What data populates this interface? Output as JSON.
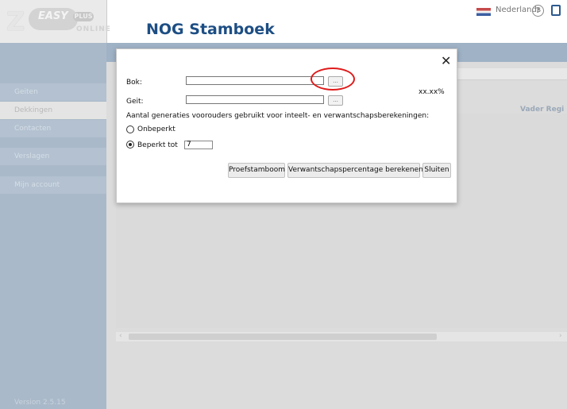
{
  "header": {
    "logo_text": "ZOO EASY PLUS ONLINE",
    "title": "NOG Stamboek",
    "language": "Nederlands",
    "help_symbol": "?"
  },
  "sidebar": {
    "items": [
      {
        "label": "Geiten"
      },
      {
        "label": "Dekkingen"
      },
      {
        "label": "Contacten"
      },
      {
        "label": "Verslagen"
      },
      {
        "label": "Mijn account"
      }
    ],
    "version": "Version 2.5.15"
  },
  "main": {
    "column_header": "Vader Regi"
  },
  "dialog": {
    "close_symbol": "✕",
    "bok_label": "Bok:",
    "geit_label": "Geit:",
    "browse_label": "...",
    "percentage": "xx.xx%",
    "generations_question": "Aantal generaties voorouders gebruikt voor inteelt- en verwantschapsberekeningen:",
    "option_unlimited": "Onbeperkt",
    "option_limited": "Beperkt tot",
    "limit_value": "7",
    "buttons": {
      "proef": "Proefstamboom",
      "calc": "Verwantschapspercentage berekenen",
      "close": "Sluiten"
    }
  },
  "colors": {
    "header_title": "#1d4e84",
    "sidebar_bg": "#aab9c9",
    "highlight": "#e01a1a"
  },
  "icons": [
    "help-icon",
    "exit-icon",
    "close-icon",
    "flag-icon"
  ]
}
